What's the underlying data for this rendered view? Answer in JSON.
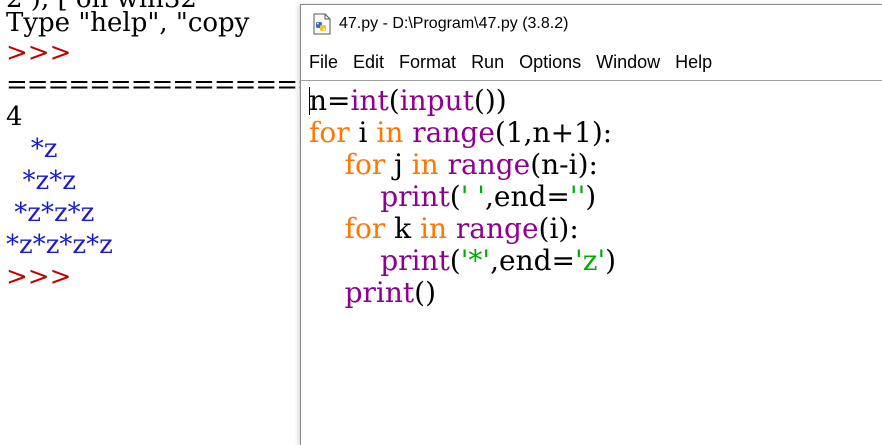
{
  "shell": {
    "line_cut": "2 ), [ on win32",
    "line_help": "Type \"help\", \"copy",
    "prompt1": ">>>",
    "separator": "====================",
    "input_value": "4",
    "out1": "   *z",
    "out2": "  *z*z",
    "out3": " *z*z*z",
    "out4": "*z*z*z*z",
    "prompt2": ">>>"
  },
  "editor": {
    "title": "47.py - D:\\Program\\47.py (3.8.2)",
    "menu": [
      "File",
      "Edit",
      "Format",
      "Run",
      "Options",
      "Window",
      "Help"
    ],
    "code": {
      "l1": {
        "a": "n=",
        "b": "int",
        "c": "(",
        "d": "input",
        "e": "())"
      },
      "l2": {
        "a": "for",
        "b": " i ",
        "c": "in",
        "d": " ",
        "e": "range",
        "f": "(1,n+1):"
      },
      "l3": {
        "a": "    ",
        "b": "for",
        "c": " j ",
        "d": "in",
        "e": " ",
        "f": "range",
        "g": "(n-i):"
      },
      "l4": {
        "a": "        ",
        "b": "print",
        "c": "(",
        "d": "' '",
        "e": ",end=",
        "f": "''",
        "g": ")"
      },
      "l5": {
        "a": "    ",
        "b": "for",
        "c": " k ",
        "d": "in",
        "e": " ",
        "f": "range",
        "g": "(i):"
      },
      "l6": {
        "a": "        ",
        "b": "print",
        "c": "(",
        "d": "'*'",
        "e": ",end=",
        "f": "'z'",
        "g": ")"
      },
      "l7": {
        "a": "    ",
        "b": "print",
        "c": "()"
      }
    }
  },
  "colors": {
    "keyword": "#ff7700",
    "builtin": "#900090",
    "string": "#00aa00",
    "prompt": "#c00000",
    "output": "#1a1ad0"
  },
  "icons": {
    "title_icon": "python-file-icon"
  }
}
